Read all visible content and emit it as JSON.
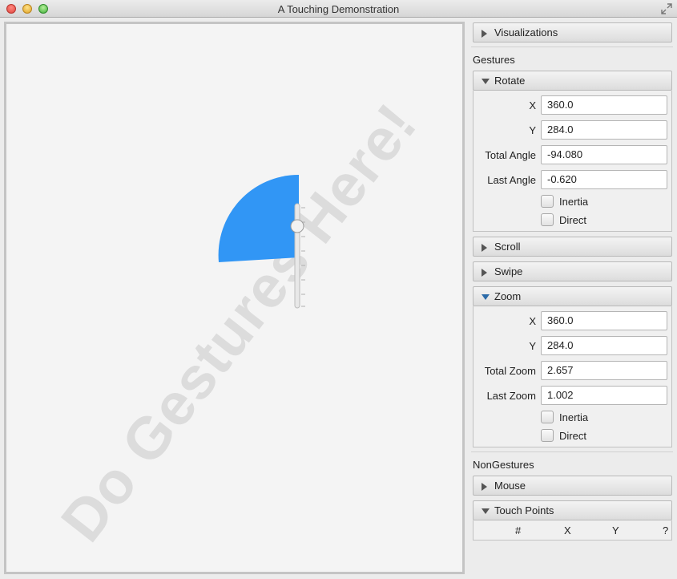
{
  "window": {
    "title": "A Touching Demonstration"
  },
  "canvas": {
    "watermark": "Do Gestures Here!",
    "shape_color": "#3196f5"
  },
  "sidebar": {
    "visualizations_label": "Visualizations",
    "gestures_label": "Gestures",
    "rotate": {
      "label": "Rotate",
      "x_label": "X",
      "x_value": "360.0",
      "y_label": "Y",
      "y_value": "284.0",
      "total_label": "Total Angle",
      "total_value": "-94.080",
      "last_label": "Last Angle",
      "last_value": "-0.620",
      "inertia_label": "Inertia",
      "inertia_checked": false,
      "direct_label": "Direct",
      "direct_checked": false
    },
    "scroll_label": "Scroll",
    "swipe_label": "Swipe",
    "zoom": {
      "label": "Zoom",
      "x_label": "X",
      "x_value": "360.0",
      "y_label": "Y",
      "y_value": "284.0",
      "total_label": "Total Zoom",
      "total_value": "2.657",
      "last_label": "Last Zoom",
      "last_value": "1.002",
      "inertia_label": "Inertia",
      "inertia_checked": false,
      "direct_label": "Direct",
      "direct_checked": false
    },
    "nongestures_label": "NonGestures",
    "mouse_label": "Mouse",
    "touch_points": {
      "label": "Touch Points",
      "columns": [
        "#",
        "X",
        "Y",
        "?"
      ]
    }
  }
}
